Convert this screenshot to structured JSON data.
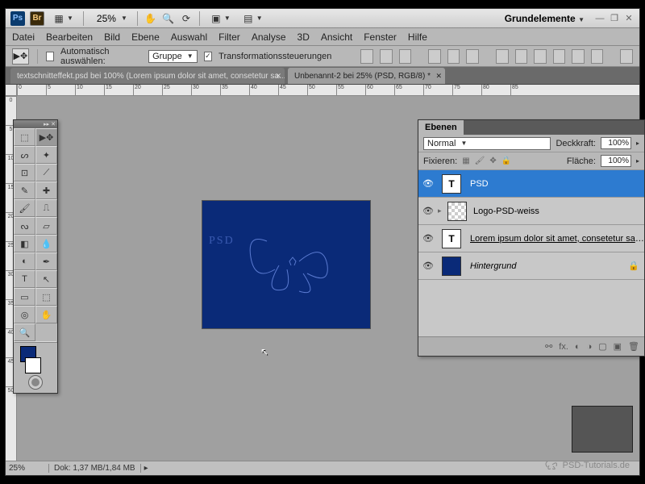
{
  "logo_ps": "Ps",
  "logo_br": "Br",
  "zoom_dropdown": "25%",
  "workspace": "Grundelemente",
  "menu": [
    "Datei",
    "Bearbeiten",
    "Bild",
    "Ebene",
    "Auswahl",
    "Filter",
    "Analyse",
    "3D",
    "Ansicht",
    "Fenster",
    "Hilfe"
  ],
  "options": {
    "autoselect": "Automatisch auswählen:",
    "group": "Gruppe",
    "transform": "Transformationssteuerungen"
  },
  "tabs": [
    {
      "label": "textschnitteffekt.psd bei 100% (Lorem ipsum dolor sit amet, consetetur sa...",
      "active": false
    },
    {
      "label": "Unbenannt-2 bei 25% (PSD, RGB/8) *",
      "active": true
    }
  ],
  "ruler_h": [
    "0",
    "5",
    "10",
    "15",
    "20",
    "25",
    "30",
    "35",
    "40",
    "45",
    "50",
    "55",
    "60",
    "65",
    "70",
    "75",
    "80",
    "85"
  ],
  "ruler_v": [
    "0",
    "5",
    "10",
    "15",
    "20",
    "25",
    "30",
    "35",
    "40",
    "45",
    "50"
  ],
  "canvas_text": "PSD",
  "status": {
    "zoom": "25%",
    "doc": "Dok: 1,37 MB/1,84 MB"
  },
  "watermark": "PSD-Tutorials.de",
  "layers_panel": {
    "title": "Ebenen",
    "blend": "Normal",
    "opacity_label": "Deckkraft:",
    "opacity_val": "100%",
    "lock_label": "Fixieren:",
    "fill_label": "Fläche:",
    "fill_val": "100%",
    "layers": [
      {
        "kind": "text",
        "thumb": "T",
        "name": "PSD",
        "selected": true
      },
      {
        "kind": "checker",
        "thumb": "",
        "name": "Logo-PSD-weiss",
        "selected": false
      },
      {
        "kind": "text",
        "thumb": "T",
        "name": "Lorem ipsum dolor sit amet, consetetur sadips...",
        "selected": false,
        "underline": true
      },
      {
        "kind": "bg",
        "thumb": "",
        "name": "Hintergrund",
        "selected": false,
        "italic": true,
        "locked": true
      }
    ]
  }
}
